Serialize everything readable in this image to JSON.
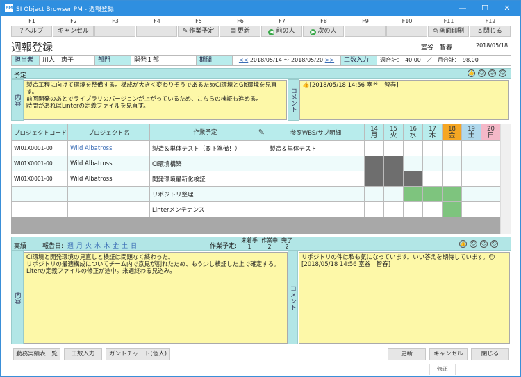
{
  "window": {
    "title": "SI Object Browser PM - 週報登録",
    "app_icon": "PM",
    "minimize": "—",
    "maximize": "☐",
    "close": "✕"
  },
  "fkeys": [
    {
      "key": "F1",
      "label": "ヘルプ",
      "icon": "help-icon"
    },
    {
      "key": "F2",
      "label": "キャンセル"
    },
    {
      "key": "F3",
      "label": ""
    },
    {
      "key": "F4",
      "label": ""
    },
    {
      "key": "F5",
      "label": "作業予定",
      "icon": "pencil-icon"
    },
    {
      "key": "F6",
      "label": "更新",
      "icon": "document-icon"
    },
    {
      "key": "F7",
      "label": "前の人",
      "icon": "arrow-left-icon"
    },
    {
      "key": "F8",
      "label": "次の人",
      "icon": "arrow-right-icon"
    },
    {
      "key": "F9",
      "label": ""
    },
    {
      "key": "F10",
      "label": ""
    },
    {
      "key": "F11",
      "label": "画面印刷",
      "icon": "printer-icon"
    },
    {
      "key": "F12",
      "label": "閉じる",
      "icon": "home-icon"
    }
  ],
  "header": {
    "page_title": "週報登録",
    "user": "室谷　智春",
    "date": "2018/05/18"
  },
  "info": {
    "assignee_label": "担当者",
    "assignee": "川人　恵子",
    "dept_label": "部門",
    "dept": "開発１部",
    "period_label": "期間",
    "prev": "<<",
    "period": "2018/05/14 ～ 2018/05/20",
    "next": ">>",
    "hours_button": "工数入力",
    "totals": "週合計：　40.00　／　月合計：　98.00"
  },
  "plan": {
    "section_label": "予定",
    "content_label": "内容",
    "content": "製造工程に向けて環境を整備する。構成が大きく変わりそうであるためCI環境とGit環境を見直す。\n前回開発のあとでライブラリのバージョンが上がっているため、こちらの検証も進める。\n時間があればLinterの定義ファイルを見直す。",
    "comment_label": "コメント",
    "comment": "👍[2018/05/18 14:56 室谷　智春]"
  },
  "reactions": [
    "👍",
    "☺",
    "☹",
    "☹"
  ],
  "table": {
    "headers": [
      "プロジェクトコード",
      "プロジェクト名",
      "作業予定",
      "参照WBS/サブ明細"
    ],
    "days": [
      {
        "d": "14",
        "w": "月"
      },
      {
        "d": "15",
        "w": "火"
      },
      {
        "d": "16",
        "w": "水"
      },
      {
        "d": "17",
        "w": "木"
      },
      {
        "d": "18",
        "w": "金"
      },
      {
        "d": "19",
        "w": "土"
      },
      {
        "d": "20",
        "w": "日"
      }
    ],
    "day_colors": {
      "normal": "#b8ecec",
      "today": "#f5a623",
      "sat": "#b0d8ec",
      "sun": "#f4b8c8"
    },
    "rows": [
      {
        "code": "WI01X0001-00",
        "name": "Wild Albatross",
        "task": "製造＆単体テスト（要下準備！）",
        "wbs": "製造＆単体テスト",
        "cells": [
          "",
          "",
          "",
          "",
          "",
          "",
          ""
        ]
      },
      {
        "code": "WI01X0001-00",
        "name": "Wild Albatross",
        "task": "CI環境構築",
        "wbs": "",
        "cells": [
          "dark",
          "dark",
          "",
          "",
          "",
          "",
          ""
        ]
      },
      {
        "code": "WI01X0001-00",
        "name": "Wild Albatross",
        "task": "開発環境最新化検証",
        "wbs": "",
        "cells": [
          "dark",
          "dark",
          "dark",
          "",
          "",
          "",
          ""
        ]
      },
      {
        "code": "",
        "name": "",
        "task": "リポジトリ整理",
        "wbs": "",
        "cells": [
          "",
          "",
          "green",
          "green",
          "green",
          "",
          ""
        ]
      },
      {
        "code": "",
        "name": "",
        "task": "Linterメンテナンス",
        "wbs": "",
        "cells": [
          "",
          "",
          "",
          "",
          "green",
          "",
          ""
        ]
      }
    ]
  },
  "actual": {
    "section_label": "実績",
    "report_day_label": "報告日:",
    "report_days": [
      "週",
      "月",
      "火",
      "水",
      "木",
      "金",
      "土",
      "日"
    ],
    "plan_status_label": "作業予定:",
    "status": [
      {
        "label": "未着手",
        "count": "1"
      },
      {
        "label": "作業中",
        "count": "2"
      },
      {
        "label": "完了",
        "count": "2"
      }
    ],
    "content_label": "内容",
    "content": "CI環境と開発環境の見直しと検証は問題なく終わった。\nリポジトリの最適構成についてチーム内で意見が割れたため、もう少し検証した上で確定する。\nLiterの定義ファイルの修正が途中。来週終わる見込み。",
    "comment_label": "コメント",
    "comment": "リポジトリの件は私も気になっています。いい答えを期待しています。☺\n[2018/05/18 14:56 室谷　智春]"
  },
  "footer": {
    "attendance": "勤務実績表一覧",
    "hours": "工数入力",
    "gantt": "ガントチャート(個人)",
    "update": "更新",
    "cancel": "キャンセル",
    "close": "閉じる",
    "status": "修正"
  }
}
